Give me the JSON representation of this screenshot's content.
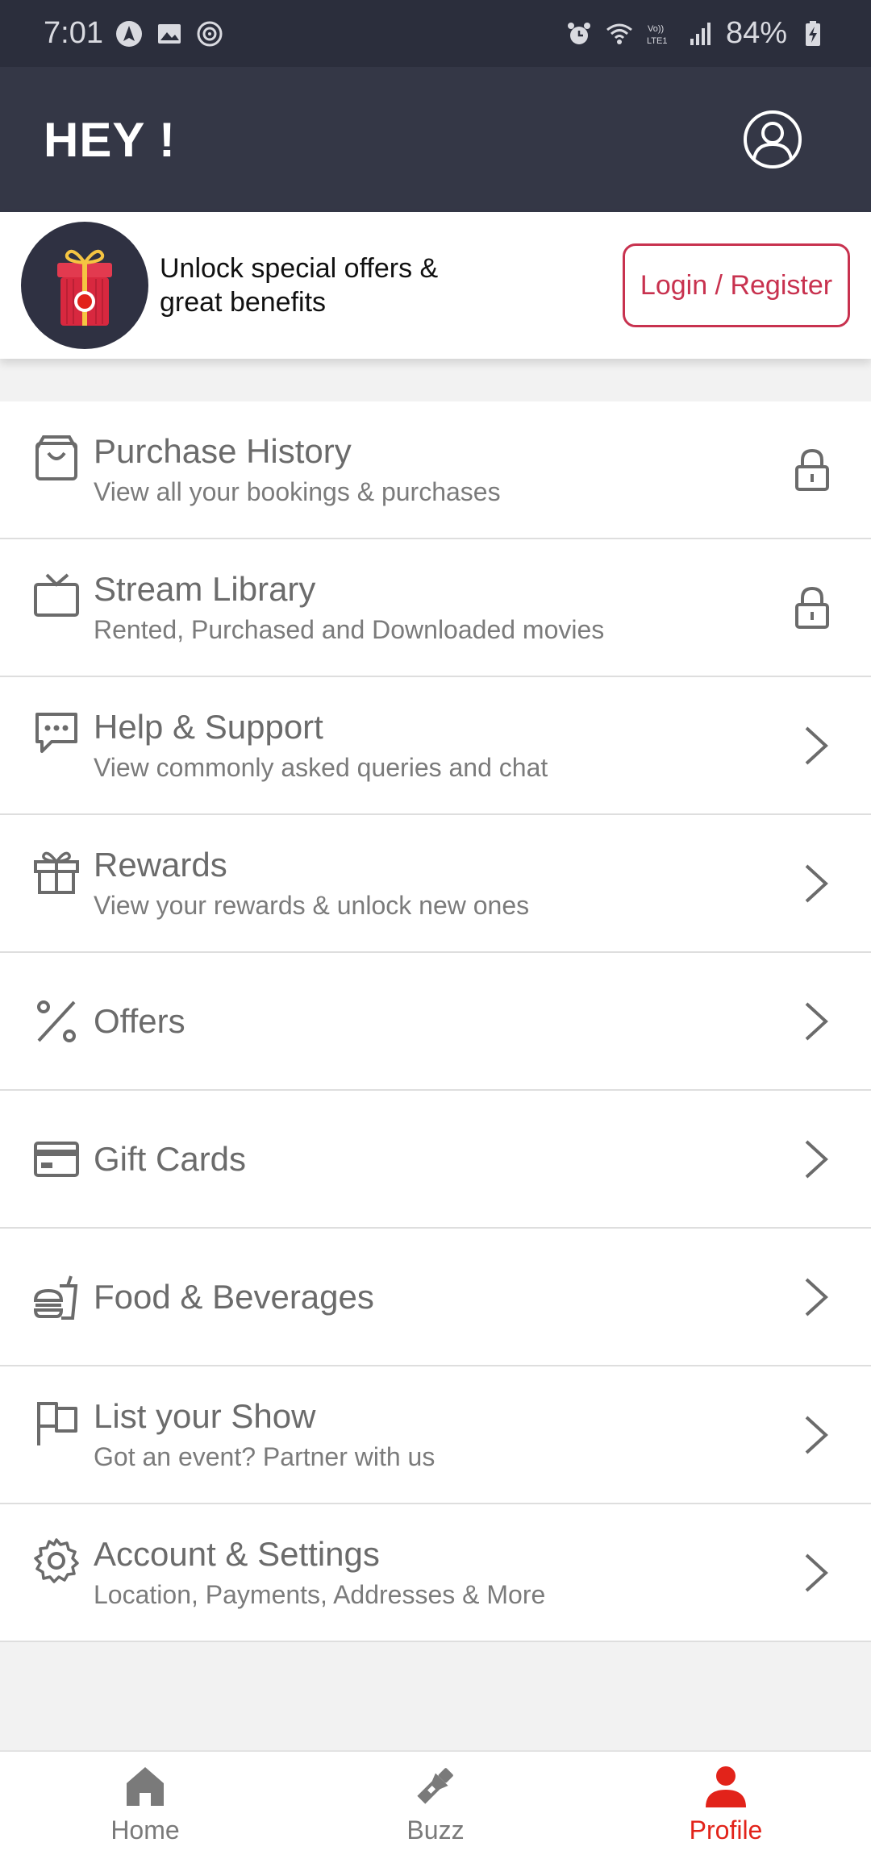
{
  "status_bar": {
    "time": "7:01",
    "battery": "84%",
    "left_icons": [
      "navigation-icon",
      "gallery-icon",
      "music-icon"
    ],
    "right_icons": [
      "alarm-icon",
      "wifi-icon",
      "volte-icon",
      "signal-icon",
      "battery-charging-icon"
    ],
    "volte_label": "Vo)) LTE1"
  },
  "header": {
    "title": "HEY !",
    "profile_icon": "user-circle-icon"
  },
  "promo": {
    "text_line1": "Unlock special offers &",
    "text_line2": "great benefits",
    "login_label": "Login / Register",
    "gift_icon": "gift-box-icon"
  },
  "menu": {
    "items": [
      {
        "title": "Purchase History",
        "subtitle": "View all your bookings & purchases",
        "icon": "shopping-bag-icon",
        "trailing": "lock-icon"
      },
      {
        "title": "Stream Library",
        "subtitle": "Rented, Purchased and Downloaded movies",
        "icon": "tv-icon",
        "trailing": "lock-icon"
      },
      {
        "title": "Help & Support",
        "subtitle": "View commonly asked queries and chat",
        "icon": "chat-icon",
        "trailing": "chevron-right-icon"
      },
      {
        "title": "Rewards",
        "subtitle": "View your rewards & unlock new ones",
        "icon": "gift-icon",
        "trailing": "chevron-right-icon"
      },
      {
        "title": "Offers",
        "subtitle": "",
        "icon": "percent-icon",
        "trailing": "chevron-right-icon"
      },
      {
        "title": "Gift Cards",
        "subtitle": "",
        "icon": "card-icon",
        "trailing": "chevron-right-icon"
      },
      {
        "title": "Food & Beverages",
        "subtitle": "",
        "icon": "food-icon",
        "trailing": "chevron-right-icon"
      },
      {
        "title": "List your Show",
        "subtitle": "Got an event? Partner with us",
        "icon": "flag-icon",
        "trailing": "chevron-right-icon"
      },
      {
        "title": "Account & Settings",
        "subtitle": "Location, Payments, Addresses & More",
        "icon": "settings-icon",
        "trailing": "chevron-right-icon"
      }
    ]
  },
  "bottom_nav": {
    "items": [
      {
        "label": "Home",
        "icon": "home-icon",
        "active": false
      },
      {
        "label": "Buzz",
        "icon": "flashlight-icon",
        "active": false
      },
      {
        "label": "Profile",
        "icon": "person-icon",
        "active": true
      }
    ],
    "active_color": "#e2231a",
    "inactive_color": "#7a7a7a"
  },
  "colors": {
    "header_bg": "#343746",
    "status_bg": "#2b2e3c",
    "accent": "#c8324f"
  }
}
